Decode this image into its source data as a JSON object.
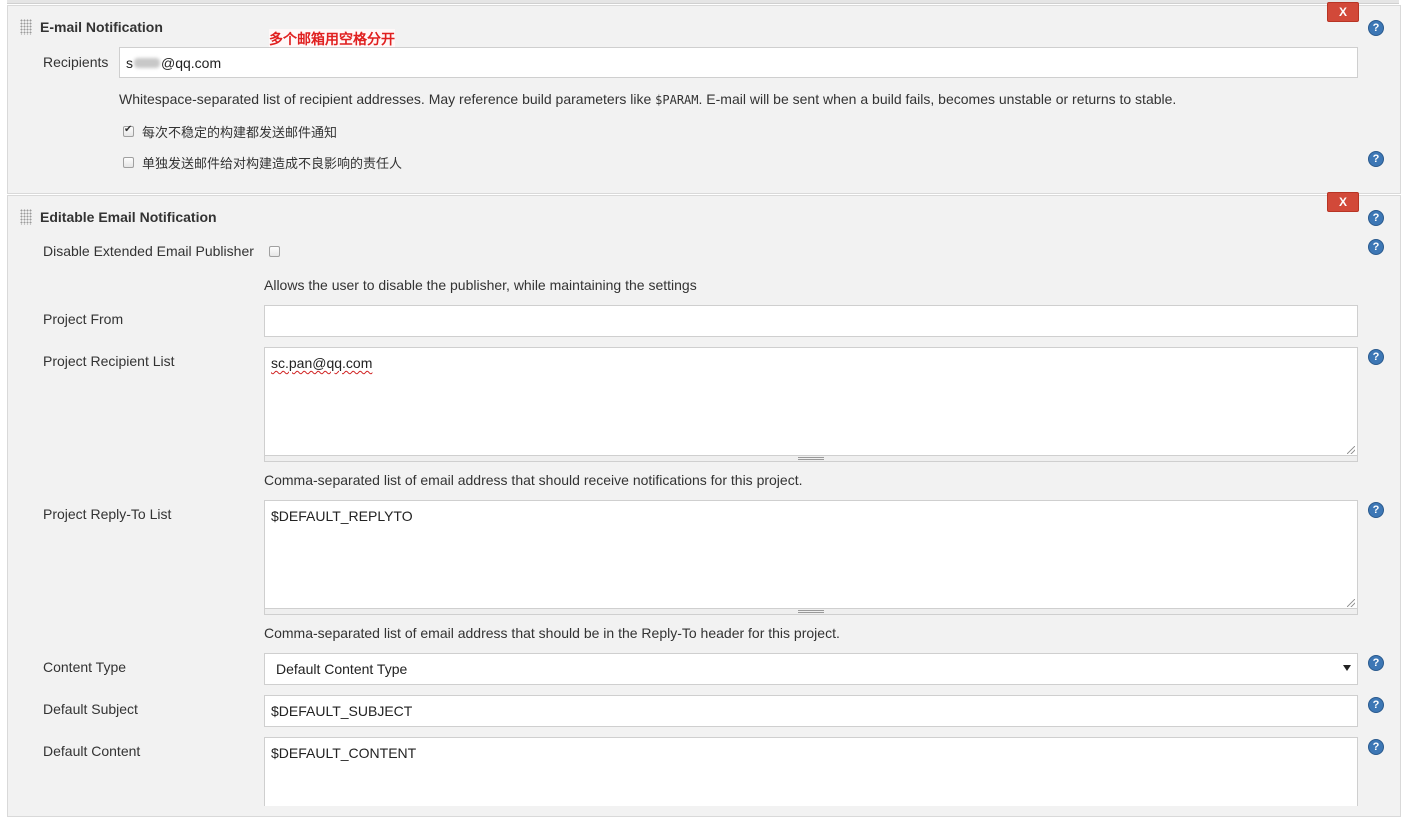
{
  "email_notification": {
    "title": "E-mail Notification",
    "annotation": "多个邮箱用空格分开",
    "delete_label": "X",
    "recipients_label": "Recipients",
    "recipients_prefix": "s",
    "recipients_suffix": "@qq.com",
    "recipients_help": "Whitespace-separated list of recipient addresses. May reference build parameters like ",
    "recipients_help_code": "$PARAM",
    "recipients_help_tail": ". E-mail will be sent when a build fails, becomes unstable or returns to stable.",
    "options": [
      {
        "label": "每次不稳定的构建都发送邮件通知",
        "checked": true
      },
      {
        "label": "单独发送邮件给对构建造成不良影响的责任人",
        "checked": false
      }
    ]
  },
  "editable_email": {
    "title": "Editable Email Notification",
    "delete_label": "X",
    "disable_label": "Disable Extended Email Publisher",
    "disable_help": "Allows the user to disable the publisher, while maintaining the settings",
    "project_from_label": "Project From",
    "project_from_value": "",
    "recipient_list_label": "Project Recipient List",
    "recipient_list_value": "sc.pan@qq.com",
    "recipient_list_help": "Comma-separated list of email address that should receive notifications for this project.",
    "reply_to_label": "Project Reply-To List",
    "reply_to_value": "$DEFAULT_REPLYTO",
    "reply_to_help": "Comma-separated list of email address that should be in the Reply-To header for this project.",
    "content_type_label": "Content Type",
    "content_type_value": "Default Content Type",
    "subject_label": "Default Subject",
    "subject_value": "$DEFAULT_SUBJECT",
    "content_label": "Default Content",
    "content_value": "$DEFAULT_CONTENT"
  },
  "help_icon_glyph": "?",
  "colors": {
    "delete_button": "#d24939",
    "help_icon": "#3d77b5",
    "annotation": "#e02020",
    "section_bg": "#f2f2f2"
  }
}
